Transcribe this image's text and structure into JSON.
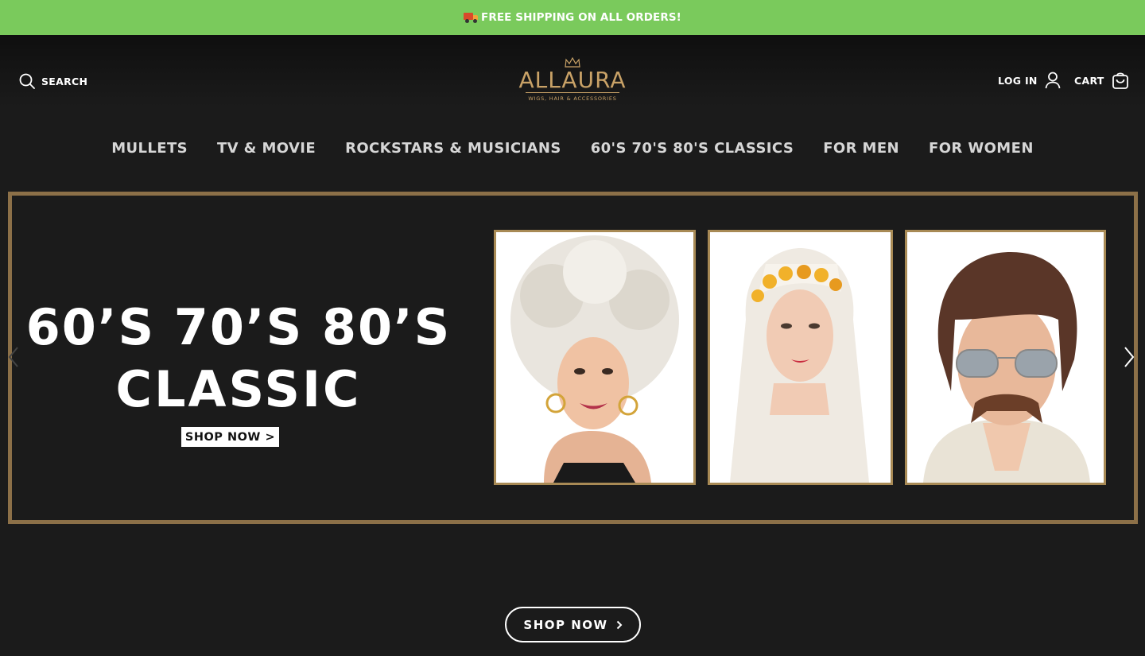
{
  "announcement": {
    "text": "FREE SHIPPING ON ALL ORDERS!",
    "icon": "delivery-truck-icon",
    "bg_color": "#7aca5c"
  },
  "header": {
    "search_label": "SEARCH",
    "logo": {
      "brand": "ALLAURA",
      "tagline": "WIGS, HAIR & ACCESSORIES"
    },
    "login_label": "LOG IN",
    "cart_label": "CART"
  },
  "nav": {
    "items": [
      {
        "label": "MULLETS"
      },
      {
        "label": "TV & MOVIE"
      },
      {
        "label": "ROCKSTARS & MUSICIANS"
      },
      {
        "label": "60'S 70'S 80'S CLASSICS"
      },
      {
        "label": "FOR MEN"
      },
      {
        "label": "FOR WOMEN"
      }
    ]
  },
  "hero": {
    "title_line1": "60’S 70’S 80’S",
    "title_line2": "CLASSIC",
    "button_label": "SHOP NOW >",
    "border_color": "#8c7048"
  },
  "cta": {
    "label": "SHOP NOW"
  },
  "colors": {
    "accent_gold": "#c9a267",
    "background": "#1b1b1b"
  }
}
